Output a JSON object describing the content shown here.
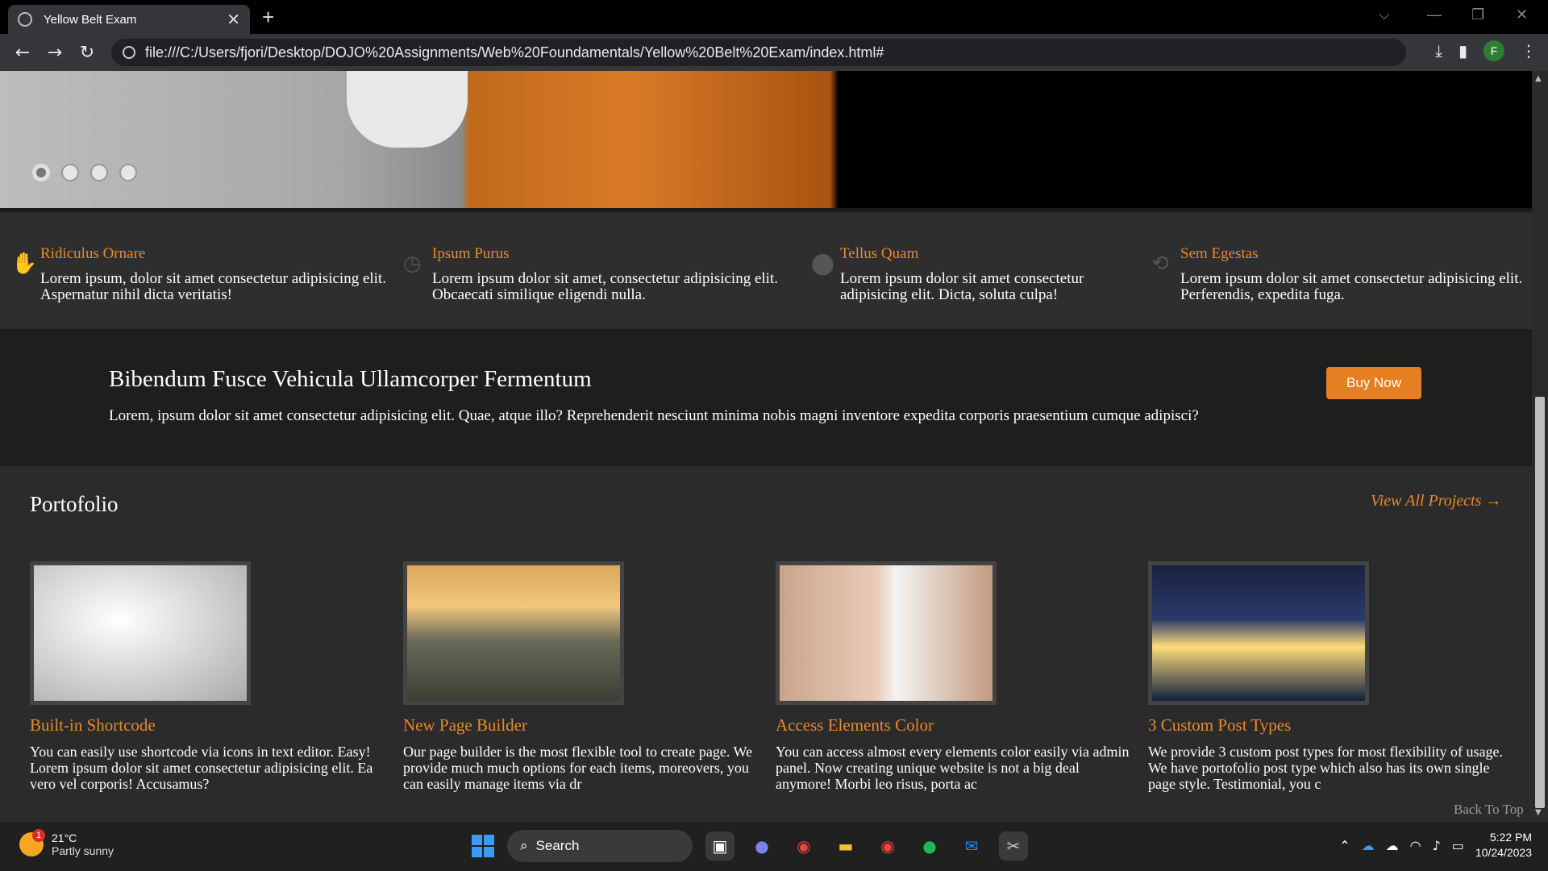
{
  "browser": {
    "tab_title": "Yellow Belt Exam",
    "tab_close": "✕",
    "new_tab": "+",
    "url": "file:///C:/Users/fjori/Desktop/DOJO%20Assignments/Web%20Foundamentals/Yellow%20Belt%20Exam/index.html#",
    "profile_initial": "F"
  },
  "hero": {
    "slide_count": 4,
    "active_slide": 1
  },
  "features": [
    {
      "title": "Ridiculus Ornare",
      "text": "Lorem ipsum, dolor sit amet consectetur adipisicing elit. Aspernatur nihil dicta veritatis!",
      "icon": "hand-icon"
    },
    {
      "title": "Ipsum Purus",
      "text": "Lorem ipsum dolor sit amet, consectetur adipisicing elit. Obcaecati similique eligendi nulla.",
      "icon": "clock-icon"
    },
    {
      "title": "Tellus Quam",
      "text": "Lorem ipsum dolor sit amet consectetur adipisicing elit. Dicta, soluta culpa!",
      "icon": "map-pin-icon"
    },
    {
      "title": "Sem Egestas",
      "text": "Lorem ipsum dolor sit amet consectetur adipisicing elit. Perferendis, expedita fuga.",
      "icon": "refresh-icon"
    }
  ],
  "cta": {
    "heading": "Bibendum Fusce Vehicula Ullamcorper Fermentum",
    "text": "Lorem, ipsum dolor sit amet consectetur adipisicing elit. Quae, atque illo? Reprehenderit nesciunt minima nobis magni inventore expedita corporis praesentium cumque adipisci?",
    "button": "Buy Now"
  },
  "portfolio": {
    "heading": "Portofolio",
    "view_all": "View All Projects →",
    "cards": [
      {
        "title": "Built-in Shortcode",
        "text": "You can easily use shortcode via icons in text editor. Easy! Lorem ipsum dolor sit amet consectetur adipisicing elit. Ea vero vel corporis! Accusamus?"
      },
      {
        "title": "New Page Builder",
        "text": "Our page builder is the most flexible tool to create page. We provide much much options for each items, moreovers, you can easily manage items via dr"
      },
      {
        "title": "Access Elements Color",
        "text": "You can access almost every elements color easily via admin panel. Now creating unique website is not a big deal anymore! Morbi leo risus, porta ac"
      },
      {
        "title": "3 Custom Post Types",
        "text": "We provide 3 custom post types for most flexibility of usage. We have portofolio post type which also has its own single page style. Testimonial, you c"
      }
    ],
    "back_to_top": "Back To Top"
  },
  "taskbar": {
    "weather_temp": "21°C",
    "weather_desc": "Partly sunny",
    "weather_badge": "1",
    "search_label": "Search",
    "time": "5:22 PM",
    "date": "10/24/2023"
  },
  "colors": {
    "accent": "#e8892d",
    "button": "#e67e22"
  }
}
